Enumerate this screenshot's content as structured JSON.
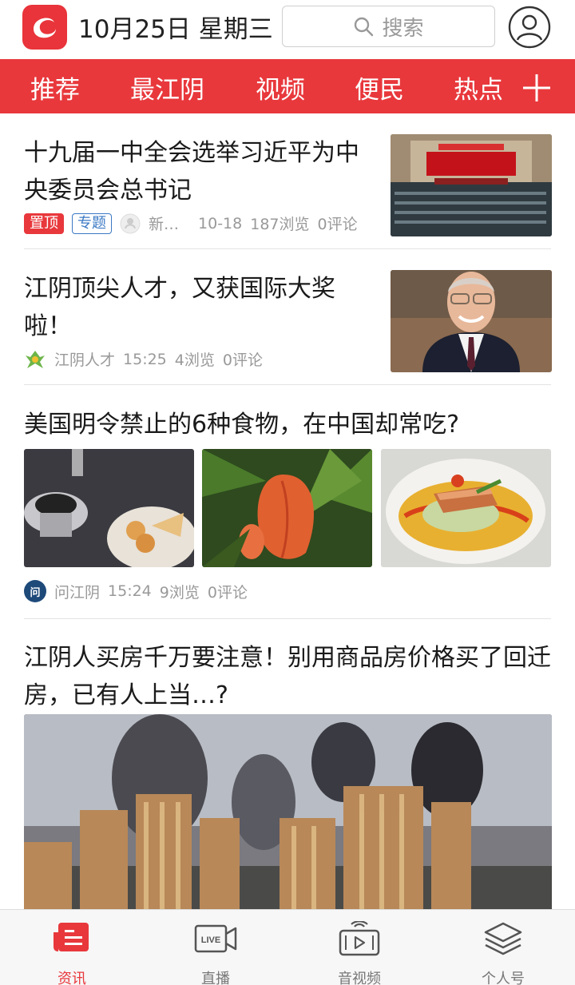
{
  "header": {
    "date": "10月25日 星期三",
    "search_placeholder": "搜索"
  },
  "tabs": [
    {
      "label": "推荐",
      "active": false
    },
    {
      "label": "最江阴",
      "active": true
    },
    {
      "label": "视频",
      "active": false
    },
    {
      "label": "便民",
      "active": false
    },
    {
      "label": "热点",
      "active": false
    }
  ],
  "articles": [
    {
      "title": "十九届一中全会选举习近平为中央委员会总书记",
      "tags": [
        "置顶",
        "专题"
      ],
      "source": "新…",
      "time": "10-18",
      "views": "187浏览",
      "comments": "0评论"
    },
    {
      "title": "江阴顶尖人才，又获国际大奖啦！",
      "source": "江阴人才",
      "time": "15:25",
      "views": "4浏览",
      "comments": "0评论"
    },
    {
      "title": "美国明令禁止的6种食物，在中国却常吃?",
      "source": "问江阴",
      "source_badge": "问",
      "time": "15:24",
      "views": "9浏览",
      "comments": "0评论"
    },
    {
      "title": "江阴人买房千万要注意！别用商品房价格买了回迁房，已有人上当…?"
    }
  ],
  "bottom_nav": [
    {
      "label": "资讯",
      "icon": "news-icon",
      "active": true
    },
    {
      "label": "直播",
      "icon": "live-icon",
      "active": false
    },
    {
      "label": "音视频",
      "icon": "audio-video-icon",
      "active": false
    },
    {
      "label": "个人号",
      "icon": "stack-icon",
      "active": false
    }
  ],
  "colors": {
    "accent": "#e8383c",
    "tag_blue": "#3a78c4"
  }
}
